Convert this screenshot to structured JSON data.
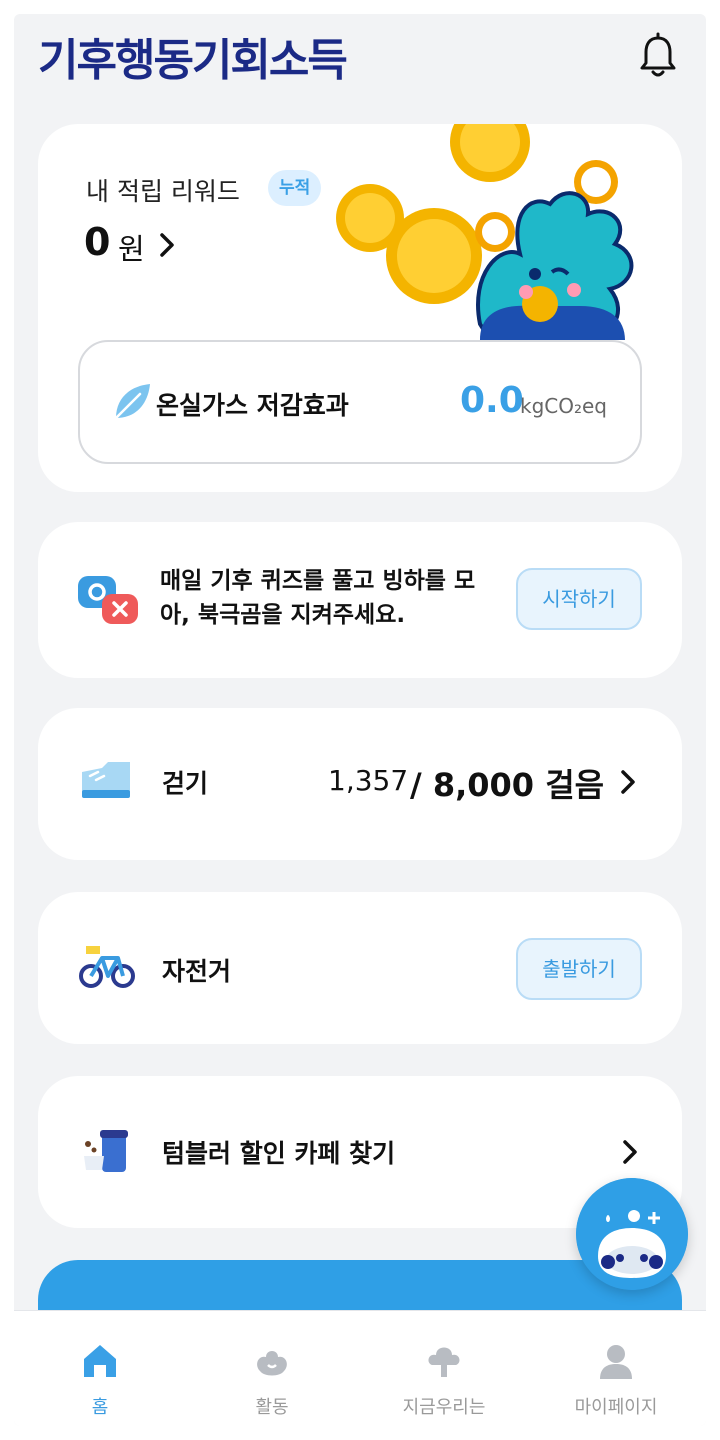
{
  "header": {
    "logo_text": "기후행동기회소득",
    "icons": {
      "notifications": "bell-icon"
    }
  },
  "reward": {
    "title": "내 적립 리워드",
    "badge": "누적",
    "amount": "0",
    "unit": "원",
    "ghg_label": "온실가스 저감효과",
    "ghg_value": "0.0",
    "ghg_unit": "kgCO₂eq"
  },
  "quiz": {
    "text": "매일 기후 퀴즈를 풀고 빙하를 모아, 북극곰을 지켜주세요.",
    "button": "시작하기"
  },
  "walk": {
    "label": "걷기",
    "current_steps": "1,357",
    "goal": "/ 8,000 걸음"
  },
  "bike": {
    "label": "자전거",
    "button": "출발하기"
  },
  "tumbler": {
    "label": "텀블러 할인 카페 찾기"
  },
  "nav": {
    "items": [
      {
        "label": "홈",
        "icon": "home-icon",
        "active": true
      },
      {
        "label": "활동",
        "icon": "activity-icon",
        "active": false
      },
      {
        "label": "지금우리는",
        "icon": "tree-icon",
        "active": false
      },
      {
        "label": "마이페이지",
        "icon": "person-icon",
        "active": false
      }
    ]
  },
  "colors": {
    "brand_navy": "#1b2a86",
    "accent_blue": "#3aa0e6",
    "background": "#f2f3f5"
  }
}
